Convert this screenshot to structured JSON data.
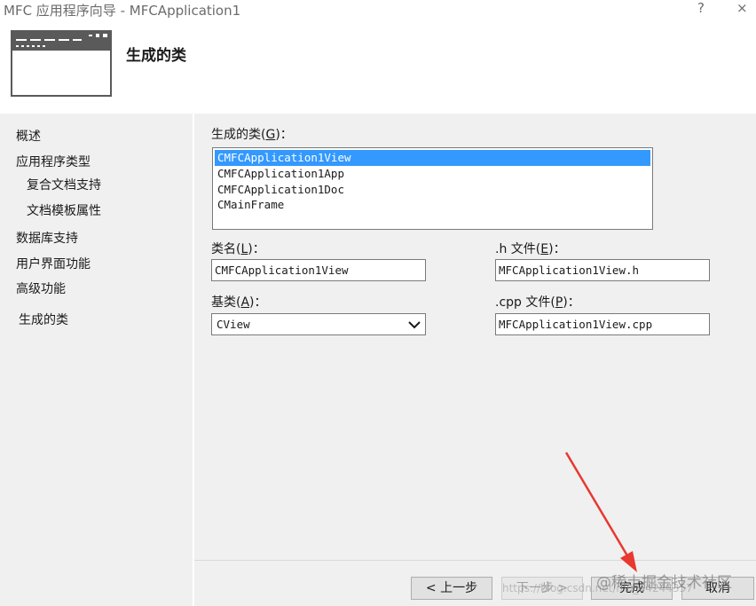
{
  "window": {
    "title": "MFC 应用程序向导 - MFCApplication1",
    "help_label": "?",
    "close_label": "×"
  },
  "header": {
    "heading": "生成的类",
    "icon": "wizard-window-icon"
  },
  "sidebar": {
    "items": [
      {
        "label": "概述"
      },
      {
        "label": "应用程序类型"
      },
      {
        "label": "复合文档支持"
      },
      {
        "label": "文档模板属性"
      },
      {
        "label": "数据库支持"
      },
      {
        "label": "用户界面功能"
      },
      {
        "label": "高级功能"
      },
      {
        "label": "生成的类"
      }
    ],
    "selected": "生成的类"
  },
  "form": {
    "classes_label": "生成的类(",
    "classes_key": "G",
    "classes_suffix": ")：",
    "classes": [
      {
        "label": "CMFCApplication1View",
        "selected": true
      },
      {
        "label": "CMFCApplication1App"
      },
      {
        "label": "CMFCApplication1Doc"
      },
      {
        "label": "CMainFrame"
      }
    ],
    "classname_label": "类名(",
    "classname_key": "L",
    "classname_suffix": ")：",
    "classname_value": "CMFCApplication1View",
    "h_label": ".h 文件(",
    "h_key": "E",
    "h_suffix": ")：",
    "h_value": "MFCApplication1View.h",
    "base_label": "基类(",
    "base_key": "A",
    "base_suffix": ")：",
    "base_value": "CView",
    "cpp_label": ".cpp 文件(",
    "cpp_key": "P",
    "cpp_suffix": ")：",
    "cpp_value": "MFCApplication1View.cpp"
  },
  "footer": {
    "prev_label": "< 上一步",
    "next_label": "下一步 >",
    "finish_label": "完成",
    "cancel_label": "取消"
  },
  "watermark": {
    "url_text": "https://blog.csdn.net/m0_64244357",
    "badge_text": "@稀土掘金技术社区"
  },
  "annotation": {
    "arrow_color": "#e8382f"
  },
  "colors": {
    "selection": "#3399ff",
    "panel_bg": "#f0f0f0"
  }
}
